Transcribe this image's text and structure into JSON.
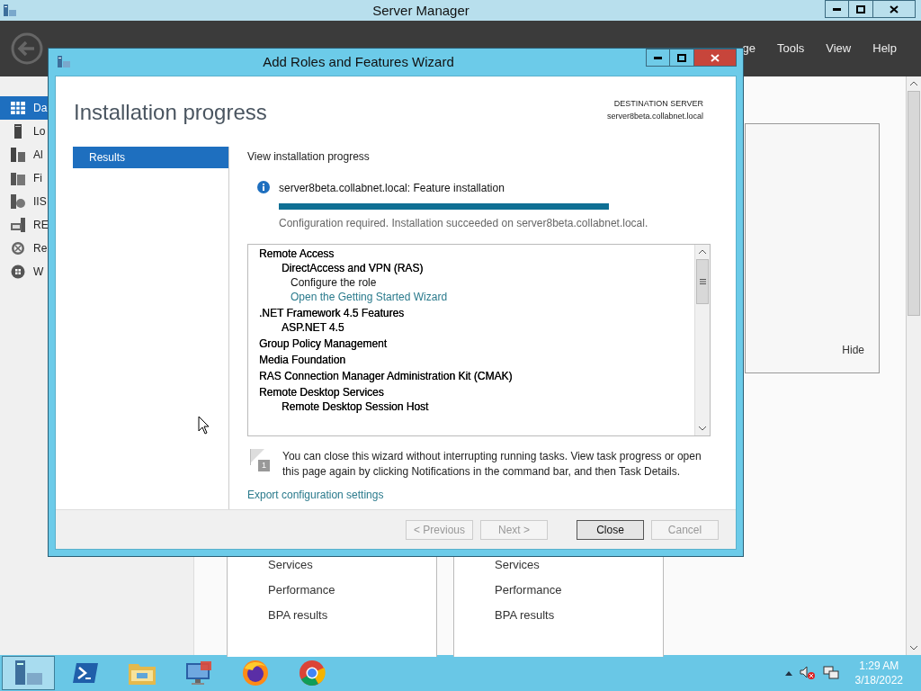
{
  "window": {
    "title": "Server Manager"
  },
  "header": {
    "menu": [
      {
        "label": "ge"
      },
      {
        "label": "Tools"
      },
      {
        "label": "View"
      },
      {
        "label": "Help"
      }
    ]
  },
  "sidebar": {
    "items": [
      {
        "label": "Da",
        "selected": true
      },
      {
        "label": "Lo",
        "selected": false
      },
      {
        "label": "Al",
        "selected": false
      },
      {
        "label": "Fi",
        "selected": false
      },
      {
        "label": "IIS",
        "selected": false
      },
      {
        "label": "RE",
        "selected": false
      },
      {
        "label": "Re",
        "selected": false
      },
      {
        "label": "W",
        "selected": false
      }
    ]
  },
  "welcome_panel": {
    "hide_label": "Hide"
  },
  "tiles": [
    {
      "links": [
        "Services",
        "Performance",
        "BPA results"
      ]
    },
    {
      "links": [
        "Services",
        "Performance",
        "BPA results"
      ]
    }
  ],
  "dialog": {
    "title": "Add Roles and Features Wizard",
    "heading": "Installation progress",
    "destination_label": "DESTINATION SERVER",
    "destination_server": "server8beta.collabnet.local",
    "nav": [
      {
        "label": "Results",
        "selected": true
      }
    ],
    "section_label": "View installation progress",
    "task": {
      "label": "server8beta.collabnet.local: Feature installation",
      "level": 1,
      "status": "Configuration required. Installation succeeded on server8beta.collabnet.local."
    },
    "results": [
      {
        "kind": "feature",
        "label": "Remote Access",
        "children": [
          {
            "kind": "feature",
            "label": "DirectAccess and VPN (RAS)",
            "children": [
              {
                "kind": "text",
                "label": "Configure the role"
              },
              {
                "kind": "link",
                "label": "Open the Getting Started Wizard"
              }
            ]
          }
        ]
      },
      {
        "kind": "feature",
        "label": ".NET Framework 4.5 Features",
        "children": [
          {
            "kind": "feature",
            "label": "ASP.NET 4.5"
          }
        ]
      },
      {
        "kind": "feature",
        "label": "Group Policy Management"
      },
      {
        "kind": "feature",
        "label": "Media Foundation"
      },
      {
        "kind": "feature",
        "label": "RAS Connection Manager Administration Kit (CMAK)"
      },
      {
        "kind": "feature",
        "label": "Remote Desktop Services",
        "children": [
          {
            "kind": "feature",
            "label": "Remote Desktop Session Host"
          }
        ]
      }
    ],
    "notice": "You can close this wizard without interrupting running tasks. View task progress or open this page again by clicking Notifications in the command bar, and then Task Details.",
    "notice_badge": "1",
    "export_link": "Export configuration settings",
    "buttons": [
      {
        "label": "< Previous",
        "disabled": true,
        "default": false
      },
      {
        "label": "Next >",
        "disabled": true,
        "default": false
      },
      {
        "label": "Close",
        "disabled": false,
        "default": true
      },
      {
        "label": "Cancel",
        "disabled": true,
        "default": false
      }
    ]
  },
  "taskbar": {
    "apps": [
      {
        "kind": "server-manager",
        "selected": true
      },
      {
        "kind": "powershell",
        "selected": false
      },
      {
        "kind": "explorer",
        "selected": false
      },
      {
        "kind": "remote-desktop",
        "selected": false
      },
      {
        "kind": "firefox",
        "selected": false
      },
      {
        "kind": "chrome",
        "selected": false
      }
    ],
    "time": "1:29 AM",
    "date": "3/18/2022"
  }
}
